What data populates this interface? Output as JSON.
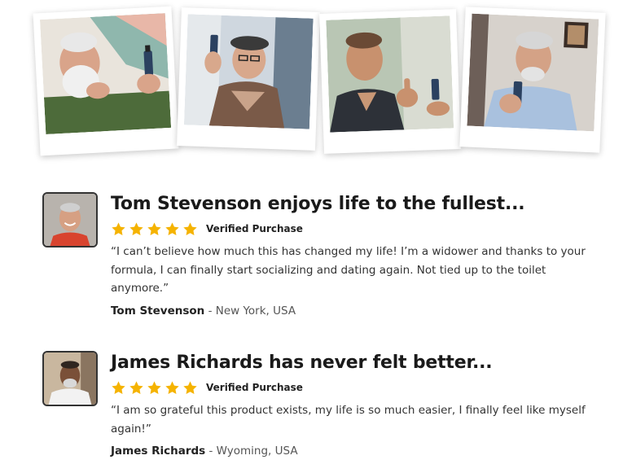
{
  "polaroids": [
    {
      "icon": "man-with-white-beard-holding-dropper-bottle"
    },
    {
      "icon": "man-with-cap-holding-dropper-bottle"
    },
    {
      "icon": "man-thumbs-up-with-dropper-bottle"
    },
    {
      "icon": "man-in-blue-shirt-holding-dropper-bottle"
    }
  ],
  "colors": {
    "star": "#f5b301",
    "heading": "#1a1a1a",
    "body": "#333333"
  },
  "reviews": [
    {
      "headline": "Tom Stevenson enjoys life to the fullest...",
      "rating": 5,
      "verified": "Verified Purchase",
      "quote": "“I can’t believe how much this has changed my life! I’m a widower and thanks to your formula, I can finally start socializing and dating again. Not tied up to the toilet anymore.”",
      "name": "Tom Stevenson",
      "location": " - New York, USA"
    },
    {
      "headline": "James Richards has never felt better...",
      "rating": 5,
      "verified": "Verified Purchase",
      "quote": "“I am so grateful this product exists, my life is so much easier, I finally feel like myself again!”",
      "name": "James Richards",
      "location": " - Wyoming, USA"
    }
  ]
}
